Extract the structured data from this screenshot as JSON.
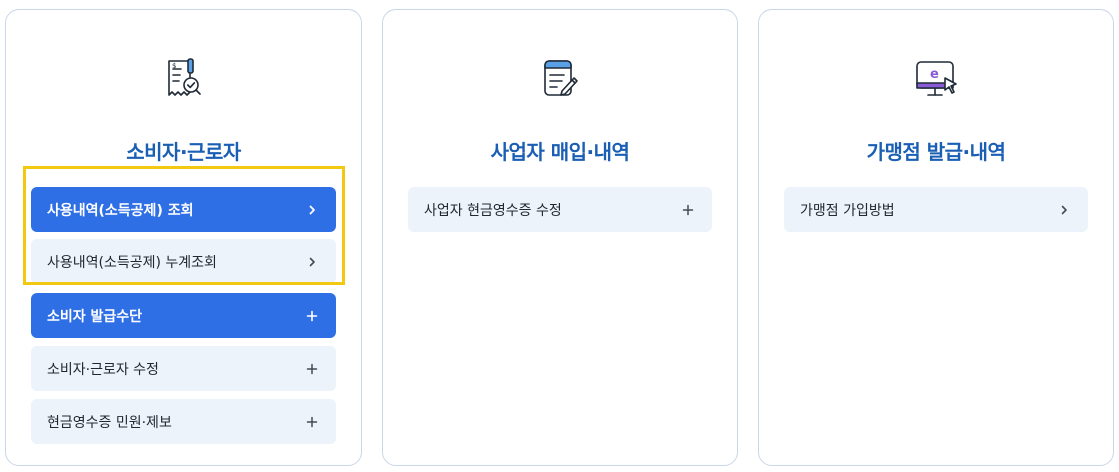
{
  "colors": {
    "accent": "#2f6fe6",
    "title": "#1a5fb4",
    "item_bg": "#edf3fb",
    "highlight": "#f2c811"
  },
  "cards": [
    {
      "icon": "receipt-check-icon",
      "title": "소비자·근로자",
      "items": [
        {
          "label": "사용내역(소득공제) 조회",
          "symbol": "chevron-right-icon",
          "active": true
        },
        {
          "label": "사용내역(소득공제) 누계조회",
          "symbol": "chevron-right-icon",
          "active": false
        },
        {
          "label": "소비자 발급수단",
          "symbol": "plus-icon",
          "active": true
        },
        {
          "label": "소비자·근로자 수정",
          "symbol": "plus-icon",
          "active": false
        },
        {
          "label": "현금영수증 민원·제보",
          "symbol": "plus-icon",
          "active": false
        }
      ]
    },
    {
      "icon": "document-pencil-icon",
      "title": "사업자 매입·내역",
      "items": [
        {
          "label": "사업자 현금영수증 수정",
          "symbol": "plus-icon",
          "active": false
        }
      ]
    },
    {
      "icon": "monitor-e-icon",
      "title": "가맹점 발급·내역",
      "items": [
        {
          "label": "가맹점 가입방법",
          "symbol": "chevron-right-icon",
          "active": false
        }
      ]
    }
  ]
}
